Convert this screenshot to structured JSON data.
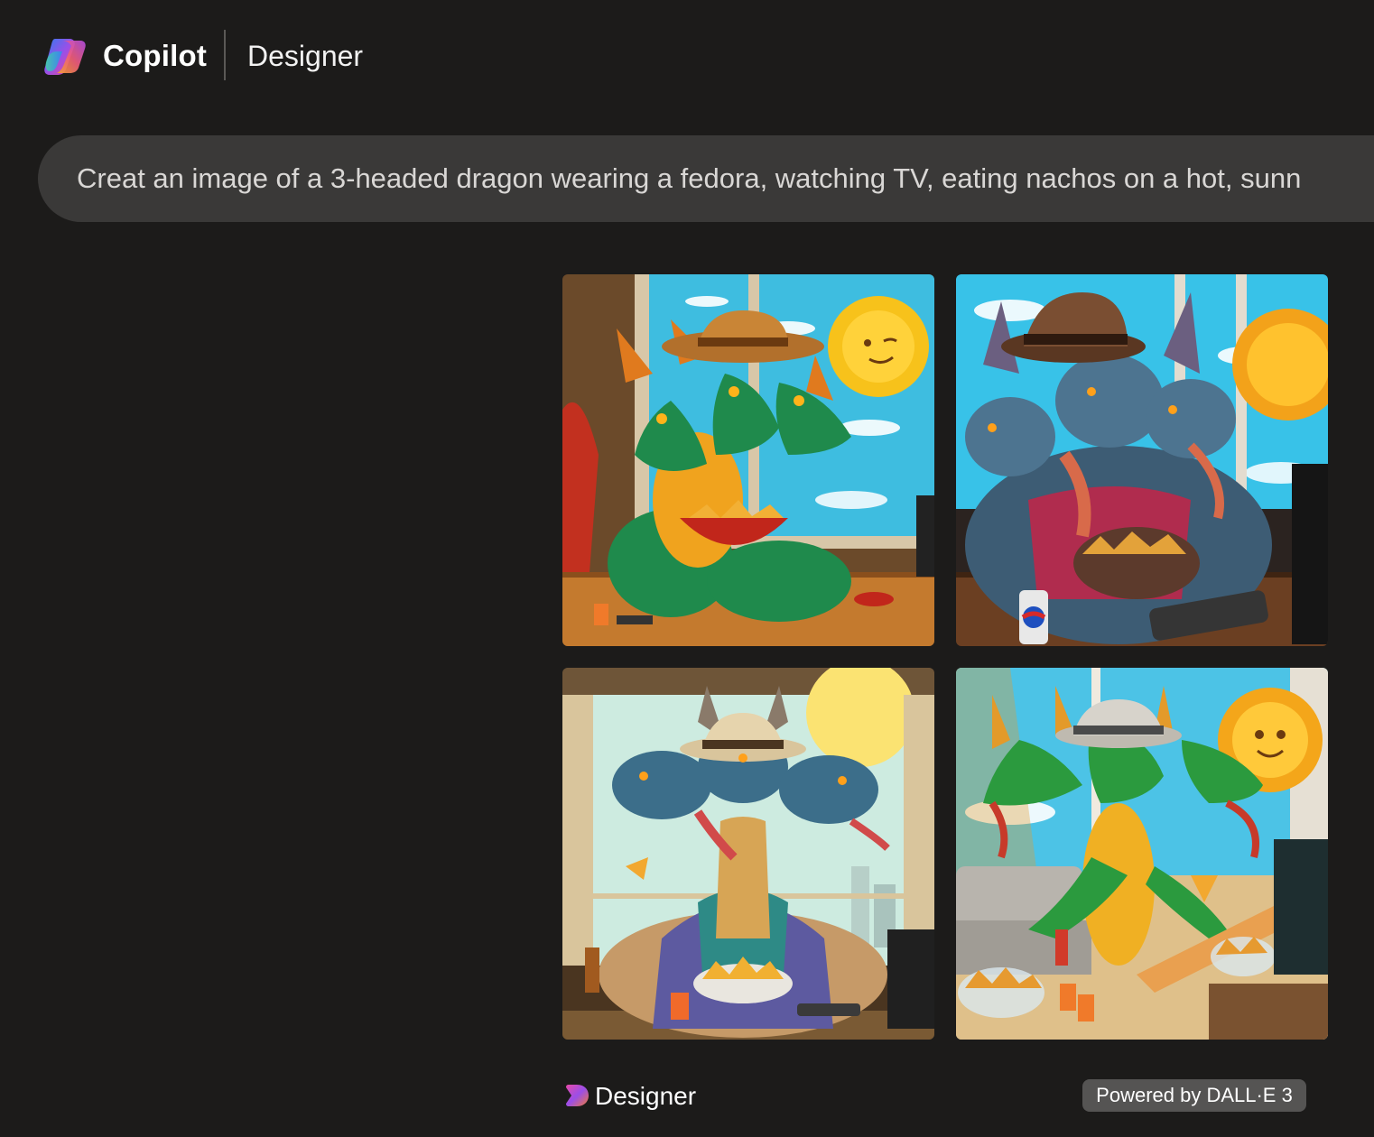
{
  "header": {
    "brand": "Copilot",
    "section": "Designer"
  },
  "prompt": {
    "text": "Creat an image of a 3-headed dragon wearing a fedora, watching TV, eating nachos on a hot, sunn"
  },
  "images": [
    {
      "id": "image-1"
    },
    {
      "id": "image-2"
    },
    {
      "id": "image-3"
    },
    {
      "id": "image-4"
    }
  ],
  "footer": {
    "designer_label": "Designer",
    "powered_by": "Powered by DALL·E 3"
  },
  "colors": {
    "background": "#1c1b1a",
    "prompt_bg": "#3a3938",
    "badge_bg": "#555453"
  }
}
